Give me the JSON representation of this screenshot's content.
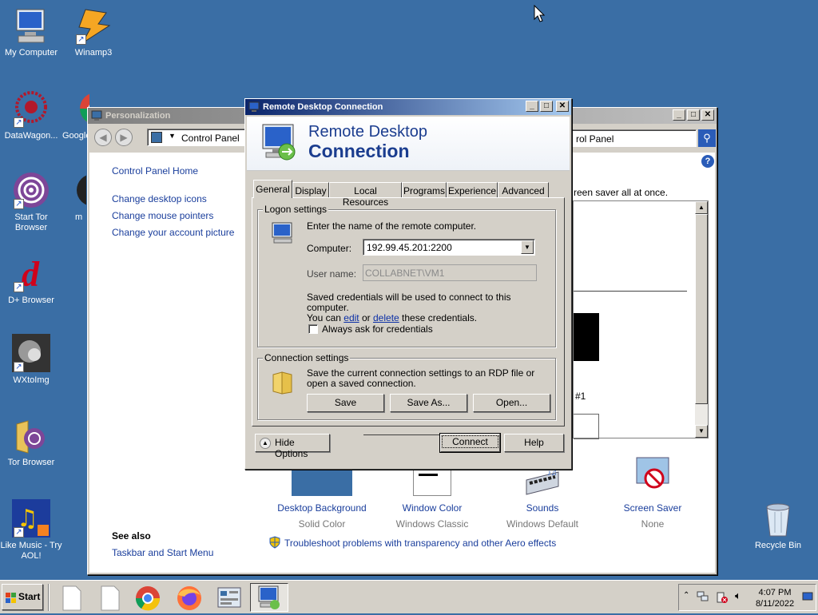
{
  "desktop": {
    "icons": [
      {
        "label": "My Computer",
        "icon": "computer-icon"
      },
      {
        "label": "Winamp3",
        "icon": "winamp-icon"
      },
      {
        "label": "DataWagon...",
        "icon": "datawagon-icon"
      },
      {
        "label": "Google",
        "icon": "chrome-icon"
      },
      {
        "label": "Start Tor Browser",
        "icon": "tor-icon"
      },
      {
        "label": "m",
        "icon": "shortcut-icon"
      },
      {
        "label": "D+ Browser",
        "icon": "dplus-icon"
      },
      {
        "label": "WXtoImg",
        "icon": "wxtoimg-icon"
      },
      {
        "label": "Tor Browser",
        "icon": "tor-folder-icon"
      },
      {
        "label": "Like Music - Try AOL!",
        "icon": "music-icon"
      },
      {
        "label": "Recycle Bin",
        "icon": "recycle-bin-icon"
      }
    ]
  },
  "personalization": {
    "title": "Personalization",
    "address": "Control Panel",
    "search": "rol Panel",
    "sidebar_links": [
      "Control Panel Home",
      "Change desktop icons",
      "Change mouse pointers",
      "Change your account picture"
    ],
    "see_also_title": "See also",
    "see_also_links": [
      "Taskbar and Start Menu"
    ],
    "body_text": "reen saver all at once.",
    "monitor_label": "#1",
    "items": [
      {
        "title": "Desktop Background",
        "sub": "Solid Color"
      },
      {
        "title": "Window Color",
        "sub": "Windows Classic"
      },
      {
        "title": "Sounds",
        "sub": "Windows Default"
      },
      {
        "title": "Screen Saver",
        "sub": "None"
      }
    ],
    "troubleshoot": "Troubleshoot problems with transparency and other Aero effects"
  },
  "rdp": {
    "title": "Remote Desktop Connection",
    "banner_line1": "Remote Desktop",
    "banner_line2": "Connection",
    "tabs": [
      "General",
      "Display",
      "Local Resources",
      "Programs",
      "Experience",
      "Advanced"
    ],
    "logon_legend": "Logon settings",
    "logon_intro": "Enter the name of the remote computer.",
    "computer_label": "Computer:",
    "computer_value": "192.99.45.201:2200",
    "username_label": "User name:",
    "username_value": "COLLABNET\\VM1",
    "creds_text1": "Saved credentials will be used to connect to this computer.",
    "creds_you_can": "You can",
    "creds_edit": "edit",
    "creds_or": "or",
    "creds_delete": "delete",
    "creds_tail": "these credentials.",
    "always_ask": "Always ask for credentials",
    "conn_legend": "Connection settings",
    "conn_text": "Save the current connection settings to an RDP file or open a saved connection.",
    "save": "Save",
    "save_as": "Save As...",
    "open": "Open...",
    "hide_options": "Hide Options",
    "connect": "Connect",
    "help": "Help"
  },
  "taskbar": {
    "start": "Start",
    "time": "4:07 PM",
    "date": "8/11/2022"
  },
  "colors": {
    "desktop": "#3a6ea5",
    "active_title": "#0a246a",
    "inactive_title": "#808080",
    "face": "#d4d0c8"
  }
}
